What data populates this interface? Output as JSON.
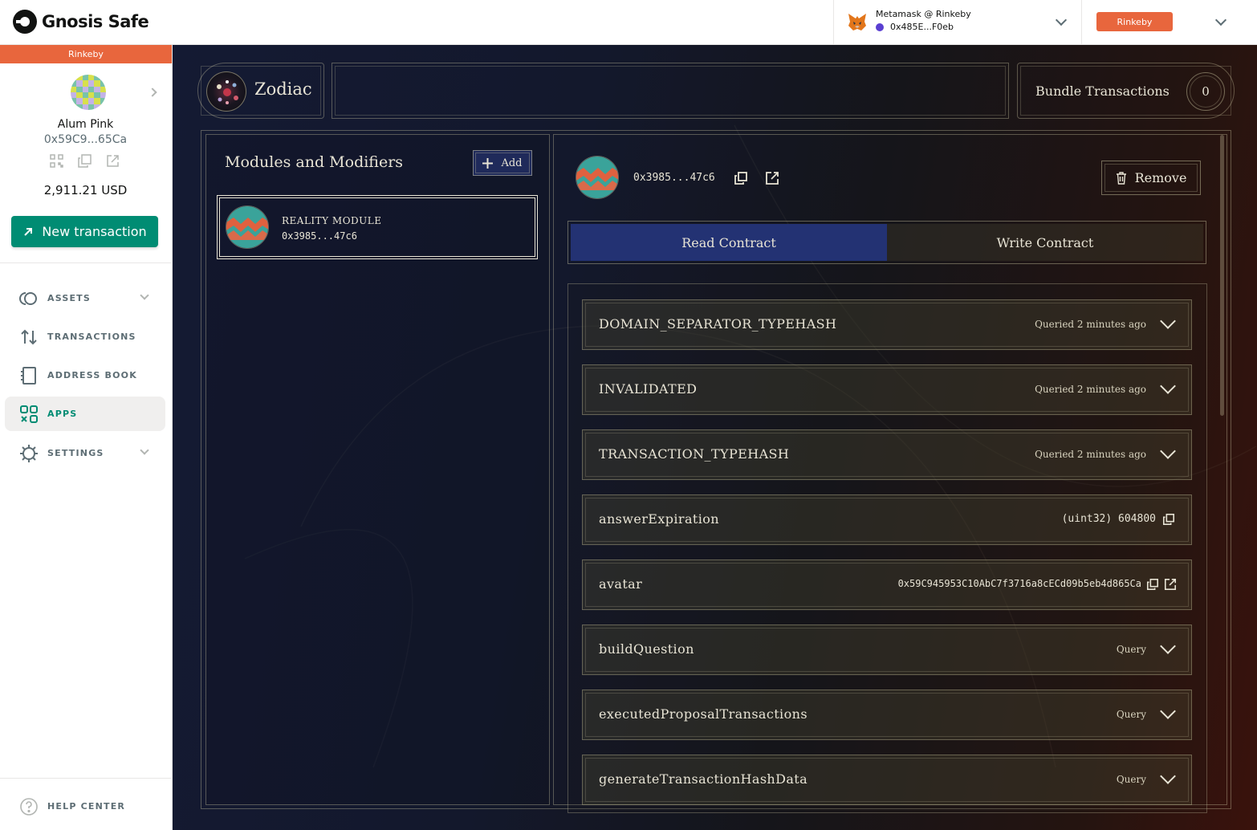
{
  "header": {
    "brand": "Gnosis Safe",
    "wallet_name": "Metamask @ Rinkeby",
    "wallet_address": "0x485E...F0eb",
    "network": "Rinkeby"
  },
  "sidebar": {
    "network_banner": "Rinkeby",
    "safe_name": "Alum Pink",
    "safe_address": "0x59C9...65Ca",
    "balance": "2,911.21 USD",
    "new_tx_label": "New transaction",
    "nav": [
      {
        "label": "ASSETS",
        "icon": "assets-icon"
      },
      {
        "label": "TRANSACTIONS",
        "icon": "transactions-icon"
      },
      {
        "label": "ADDRESS BOOK",
        "icon": "address-book-icon"
      },
      {
        "label": "APPS",
        "icon": "apps-icon",
        "active": true
      },
      {
        "label": "SETTINGS",
        "icon": "settings-icon"
      }
    ],
    "help_label": "HELP CENTER"
  },
  "app": {
    "title": "Zodiac",
    "bundle_label": "Bundle Transactions",
    "bundle_count": "0",
    "modules_title": "Modules and Modifiers",
    "add_label": "Add",
    "module": {
      "name": "REALITY MODULE",
      "address": "0x3985...47c6"
    },
    "contract_address": "0x3985...47c6",
    "remove_label": "Remove",
    "tabs": {
      "read": "Read Contract",
      "write": "Write Contract"
    },
    "functions": [
      {
        "name": "DOMAIN_SEPARATOR_TYPEHASH",
        "status": "Queried 2 minutes ago"
      },
      {
        "name": "INVALIDATED",
        "status": "Queried 2 minutes ago"
      },
      {
        "name": "TRANSACTION_TYPEHASH",
        "status": "Queried 2 minutes ago"
      },
      {
        "name": "answerExpiration",
        "value": "(uint32) 604800"
      },
      {
        "name": "avatar",
        "value": "0x59C945953C10AbC7f3716a8cECd09b5eb4d865Ca"
      },
      {
        "name": "buildQuestion",
        "status": "Query"
      },
      {
        "name": "executedProposalTransactions",
        "status": "Query"
      },
      {
        "name": "generateTransactionHashData",
        "status": "Query"
      }
    ]
  },
  "colors": {
    "accent": "#008c73",
    "network": "#e8663d",
    "tab_active": "#233273",
    "text_light": "#e8e4d5"
  }
}
